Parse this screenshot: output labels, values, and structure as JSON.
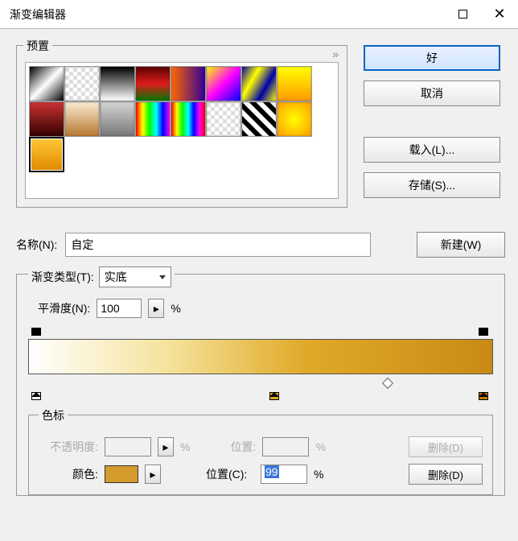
{
  "title": "渐变编辑器",
  "presets": {
    "label": "预置",
    "arrows": "»"
  },
  "buttons": {
    "ok": "好",
    "cancel": "取消",
    "load": "载入(L)...",
    "save": "存储(S)...",
    "new": "新建(W)"
  },
  "name": {
    "label": "名称(N):",
    "value": "自定"
  },
  "gtype": {
    "label": "渐变类型(T):",
    "value": "实底"
  },
  "smooth": {
    "label": "平滑度(N):",
    "value": "100",
    "pct": "%",
    "arrow": "▸"
  },
  "stops": {
    "legend": "色标",
    "opacity_label": "不透明度:",
    "pos_label": "位置:",
    "pos2_label": "位置(C):",
    "color_label": "颜色:",
    "del": "删除(D)",
    "pct": "%",
    "pos_value": "99",
    "arrow": "▸"
  },
  "swatches": [
    [
      "linear-gradient(135deg,#000,#fff,#000)",
      "repeating-conic-gradient(#ddd 0 25%,#fff 0 50%) 0/10px 10px",
      "linear-gradient(#000,#fff)",
      "linear-gradient(#5b0000,#dd1c1c,#070)",
      "linear-gradient(90deg,#f60,#309)",
      "linear-gradient(135deg,#ff0,#f0f,#00f)",
      "linear-gradient(120deg,#00a,#ff0,#00a,#ff0)",
      "linear-gradient(#ff0,#f90)"
    ],
    [
      "linear-gradient(#c33,#300)",
      "linear-gradient(#fbead0,#b77832)",
      "linear-gradient(#d5d5d5,#777)",
      "linear-gradient(90deg,#f00,#ff0,#0f0,#0ff,#00f,#f0f)",
      "linear-gradient(90deg,#f00,#ff0,#0f0,#0ff,#00f,#f0f,#f00)",
      "repeating-conic-gradient(#ddd 0 25%,#fff 0 50%) 0/10px 10px",
      "repeating-linear-gradient(45deg,#000 0 6px,#fff 6px 12px)",
      "radial-gradient(#ff0,#f90)"
    ],
    [
      "linear-gradient(#ffc738,#e08900)"
    ]
  ],
  "colors": {
    "stop_white": "#ffffff",
    "stop_gold": "#e0a928",
    "stop_dark": "#c07800"
  }
}
